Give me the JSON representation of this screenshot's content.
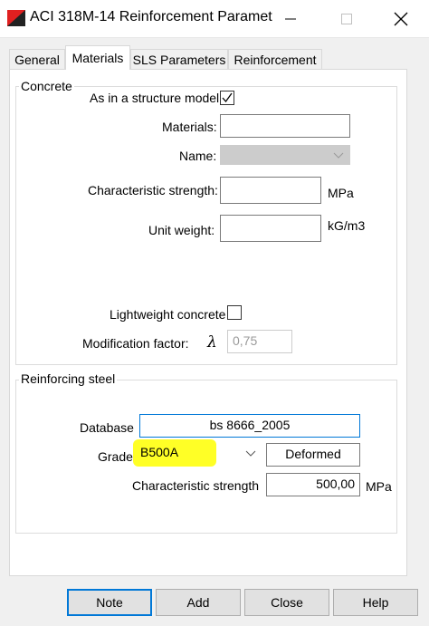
{
  "window": {
    "title": "ACI 318M-14 Reinforcement Paramet...",
    "icon": "app-logo-icon",
    "controls": [
      "minimize-icon",
      "maximize-icon",
      "close-icon"
    ]
  },
  "tabs": [
    {
      "label": "General",
      "active": false
    },
    {
      "label": "Materials",
      "active": true
    },
    {
      "label": "SLS Parameters",
      "active": false
    },
    {
      "label": "Reinforcement",
      "active": false
    }
  ],
  "concrete": {
    "group_label": "Concrete",
    "as_in_model_label": "As in a structure model",
    "as_in_model_checked": true,
    "materials_label": "Materials:",
    "materials_value": "",
    "name_label": "Name:",
    "name_value": "",
    "char_strength_label": "Characteristic strength:",
    "char_strength_value": "",
    "char_strength_unit": "MPa",
    "unit_weight_label": "Unit weight:",
    "unit_weight_value": "",
    "unit_weight_unit": "kG/m3",
    "lightweight_label": "Lightweight concrete",
    "lightweight_checked": false,
    "modification_label": "Modification factor:",
    "lambda_symbol": "λ",
    "modification_value": "0,75"
  },
  "steel": {
    "group_label": "Reinforcing steel",
    "database_label": "Database",
    "database_value": "bs 8666_2005",
    "grade_label": "Grade",
    "grade_value": "B500A",
    "bar_type_value": "Deformed",
    "char_strength_label": "Characteristic strength",
    "char_strength_value": "500,00",
    "char_strength_unit": "MPa"
  },
  "buttons": {
    "note": "Note",
    "add": "Add",
    "close": "Close",
    "help": "Help"
  },
  "colors": {
    "accent": "#0078d7",
    "highlight": "#ffff00",
    "logo_red": "#e02020"
  }
}
